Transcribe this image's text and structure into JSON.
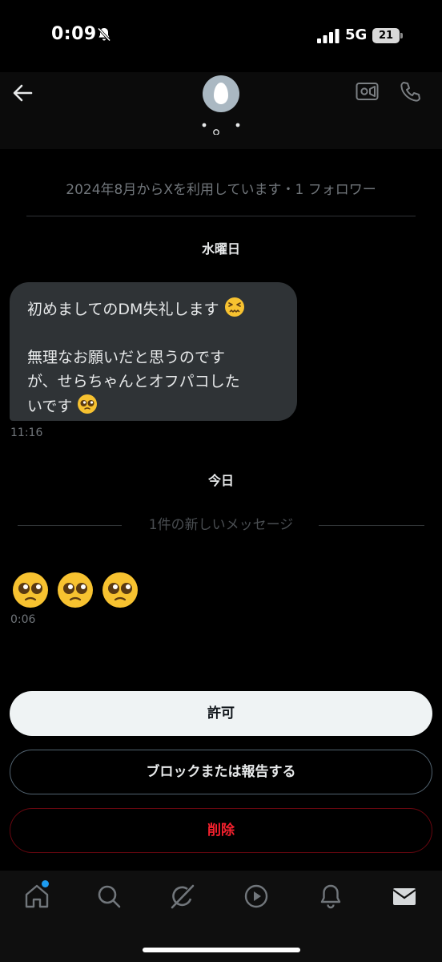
{
  "status_bar": {
    "time": "0:09",
    "network": "5G",
    "battery": "21"
  },
  "header": {
    "contact_name_dots": "・。・",
    "back_icon": "arrow-left-icon",
    "video_icon": "video-camera-icon",
    "phone_icon": "phone-icon"
  },
  "profile_info": "2024年8月からXを利用しています・1 フォロワー",
  "conversation": {
    "day1": "水曜日",
    "message1": {
      "line1": "初めましてのDM失礼します",
      "line2": "無理なお願いだと思うのです",
      "line3": "が、せらちゃんとオフパコした",
      "line4": "いです",
      "time": "11:16"
    },
    "day2": "今日",
    "new_messages_divider": "1件の新しいメッセージ",
    "message2": {
      "emoji_count": 3,
      "time": "0:06"
    }
  },
  "actions": {
    "allow": "許可",
    "block_report": "ブロックまたは報告する",
    "delete": "削除"
  },
  "tabs": [
    "home-icon",
    "search-icon",
    "grok-icon",
    "play-icon",
    "bell-icon",
    "mail-icon"
  ],
  "colors": {
    "accent": "#1d9bf0",
    "danger": "#f4212e",
    "bubble": "#2f3336"
  }
}
